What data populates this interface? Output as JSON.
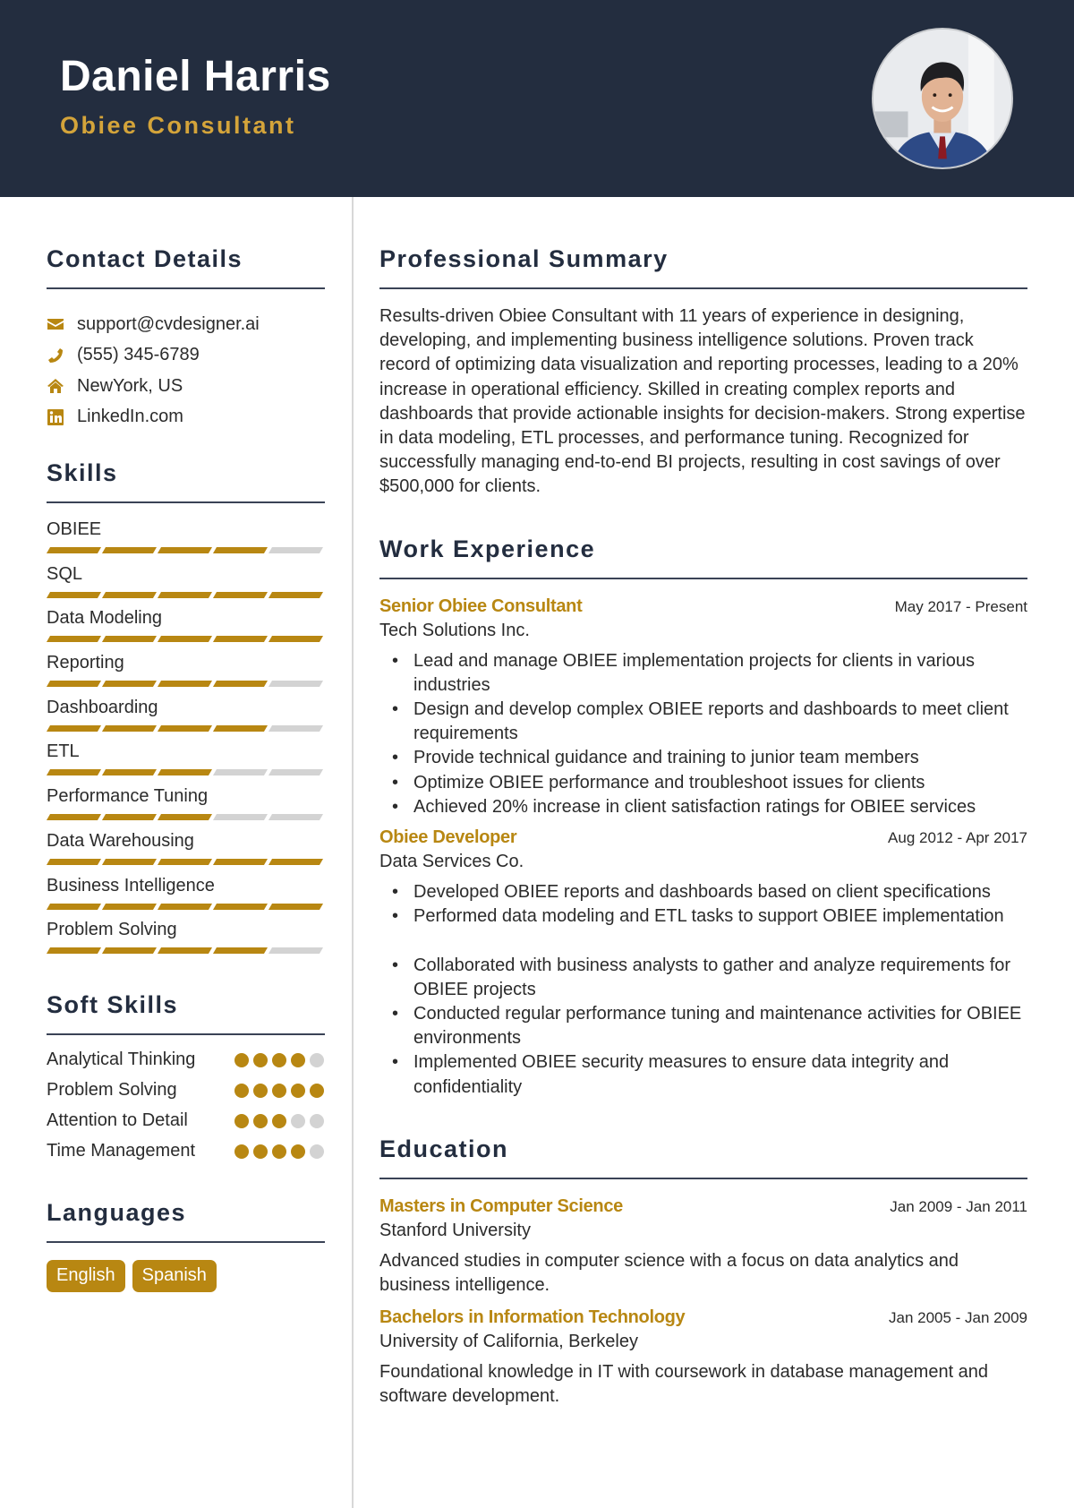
{
  "header": {
    "name": "Daniel Harris",
    "title": "Obiee Consultant",
    "photo_alt": "profile-photo"
  },
  "colors": {
    "header_bg": "#232d3f",
    "accent": "#b88712",
    "title_gold": "#d4a43a",
    "inactive": "#d3d3d3"
  },
  "sidebar": {
    "contact": {
      "heading": "Contact Details",
      "items": [
        {
          "icon": "envelope-icon",
          "text": "support@cvdesigner.ai"
        },
        {
          "icon": "phone-icon",
          "text": "(555) 345-6789"
        },
        {
          "icon": "home-icon",
          "text": "NewYork, US"
        },
        {
          "icon": "linkedin-icon",
          "text": "LinkedIn.com"
        }
      ]
    },
    "skills": {
      "heading": "Skills",
      "max": 5,
      "items": [
        {
          "name": "OBIEE",
          "level": 4
        },
        {
          "name": "SQL",
          "level": 5
        },
        {
          "name": "Data Modeling",
          "level": 5
        },
        {
          "name": "Reporting",
          "level": 4
        },
        {
          "name": "Dashboarding",
          "level": 4
        },
        {
          "name": "ETL",
          "level": 3
        },
        {
          "name": "Performance Tuning",
          "level": 3
        },
        {
          "name": "Data Warehousing",
          "level": 5
        },
        {
          "name": "Business Intelligence",
          "level": 5
        },
        {
          "name": "Problem Solving",
          "level": 4
        }
      ]
    },
    "soft_skills": {
      "heading": "Soft Skills",
      "max": 5,
      "items": [
        {
          "name": "Analytical Thinking",
          "level": 4
        },
        {
          "name": "Problem Solving",
          "level": 5
        },
        {
          "name": "Attention to Detail",
          "level": 3
        },
        {
          "name": "Time Management",
          "level": 4
        }
      ]
    },
    "languages": {
      "heading": "Languages",
      "items": [
        "English",
        "Spanish"
      ]
    }
  },
  "main": {
    "summary": {
      "heading": "Professional Summary",
      "text": "Results-driven Obiee Consultant with 11 years of experience in designing, developing, and implementing business intelligence solutions. Proven track record of optimizing data visualization and reporting processes, leading to a 20% increase in operational efficiency. Skilled in creating complex reports and dashboards that provide actionable insights for decision-makers. Strong expertise in data modeling, ETL processes, and performance tuning. Recognized for successfully managing end-to-end BI projects, resulting in cost savings of over $500,000 for clients."
    },
    "work": {
      "heading": "Work Experience",
      "jobs": [
        {
          "role": "Senior Obiee Consultant",
          "dates": "May 2017 - Present",
          "company": "Tech Solutions Inc.",
          "bullets": [
            "Lead and manage OBIEE implementation projects for clients in various industries",
            "Design and develop complex OBIEE reports and dashboards to meet client requirements",
            "Provide technical guidance and training to junior team members",
            "Optimize OBIEE performance and troubleshoot issues for clients",
            "Achieved 20% increase in client satisfaction ratings for OBIEE services"
          ]
        },
        {
          "role": "Obiee Developer",
          "dates": "Aug 2012 - Apr 2017",
          "company": "Data Services Co.",
          "bullets": [
            "Developed OBIEE reports and dashboards based on client specifications",
            "Performed data modeling and ETL tasks to support OBIEE implementation",
            "Collaborated with business analysts to gather and analyze requirements for OBIEE projects",
            "Conducted regular performance tuning and maintenance activities for OBIEE environments",
            "Implemented OBIEE security measures to ensure data integrity and confidentiality"
          ]
        }
      ]
    },
    "education": {
      "heading": "Education",
      "items": [
        {
          "degree": "Masters in Computer Science",
          "dates": "Jan 2009 - Jan 2011",
          "school": "Stanford University",
          "description": "Advanced studies in computer science with a focus on data analytics and business intelligence."
        },
        {
          "degree": "Bachelors in Information Technology",
          "dates": "Jan 2005 - Jan 2009",
          "school": "University of California, Berkeley",
          "description": "Foundational knowledge in IT with coursework in database management and software development."
        }
      ]
    }
  }
}
